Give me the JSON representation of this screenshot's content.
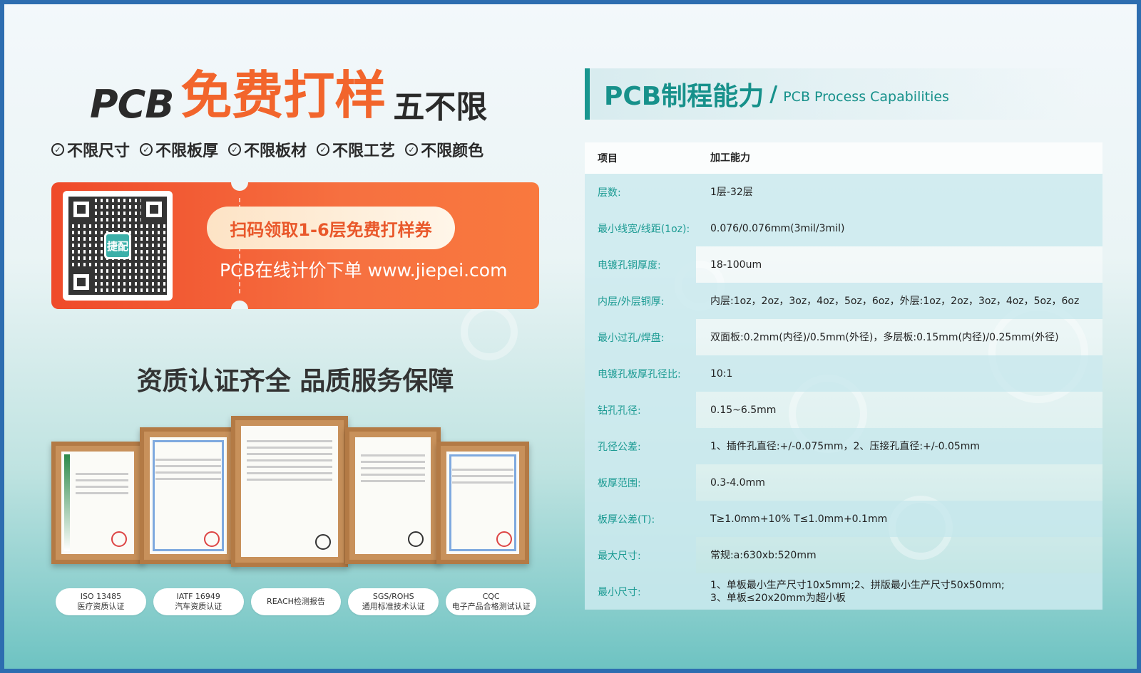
{
  "headline": {
    "prefix": "PCB",
    "highlight": "免费打样",
    "suffix": "五不限"
  },
  "features": [
    "不限尺寸",
    "不限板厚",
    "不限板材",
    "不限工艺",
    "不限颜色"
  ],
  "coupon": {
    "qr_logo": "捷配",
    "pill_text": "扫码领取1-6层免费打样券",
    "url_text": "PCB在线计价下单 www.jiepei.com"
  },
  "certifications": {
    "title": "资质认证齐全 品质服务保障",
    "labels": [
      {
        "line1": "ISO 13485",
        "line2": "医疗资质认证"
      },
      {
        "line1": "IATF 16949",
        "line2": "汽车资质认证"
      },
      {
        "line1": "REACH检测报告",
        "line2": ""
      },
      {
        "line1": "SGS/ROHS",
        "line2": "通用标准技术认证"
      },
      {
        "line1": "CQC",
        "line2": "电子产品合格测试认证"
      }
    ]
  },
  "process": {
    "title_cn": "PCB制程能力",
    "separator": "/",
    "title_en": "PCB Process Capabilities",
    "header": {
      "key": "项目",
      "value": "加工能力"
    },
    "rows": [
      {
        "key": "层数:",
        "value": "1层-32层"
      },
      {
        "key": "最小线宽/线距(1oz):",
        "value": "0.076/0.076mm(3mil/3mil)"
      },
      {
        "key": "电镀孔铜厚度:",
        "value": "18-100um"
      },
      {
        "key": "内层/外层铜厚:",
        "value": "内层:1oz，2oz，3oz，4oz，5oz，6oz，外层:1oz，2oz，3oz，4oz，5oz，6oz"
      },
      {
        "key": "最小过孔/焊盘:",
        "value": "双面板:0.2mm(内径)/0.5mm(外径)，多层板:0.15mm(内径)/0.25mm(外径)"
      },
      {
        "key": "电镀孔板厚孔径比:",
        "value": "10:1"
      },
      {
        "key": "钻孔孔径:",
        "value": "0.15~6.5mm"
      },
      {
        "key": "孔径公差:",
        "value": "1、插件孔直径:+/-0.075mm，2、压接孔直径:+/-0.05mm"
      },
      {
        "key": "板厚范围:",
        "value": "0.3-4.0mm"
      },
      {
        "key": "板厚公差(T):",
        "value": "T≥1.0mm+10% T≤1.0mm+0.1mm"
      },
      {
        "key": "最大尺寸:",
        "value": "常规:a:630xb:520mm"
      },
      {
        "key": "最小尺寸:",
        "value": "1、单板最小生产尺寸10x5mm;2、拼版最小生产尺寸50x50mm;",
        "value2": "3、单板≤20x20mm为超小板"
      }
    ]
  },
  "colors": {
    "accent_orange": "#f2652c",
    "accent_teal": "#17918b",
    "frame_blue": "#2d6db0"
  }
}
